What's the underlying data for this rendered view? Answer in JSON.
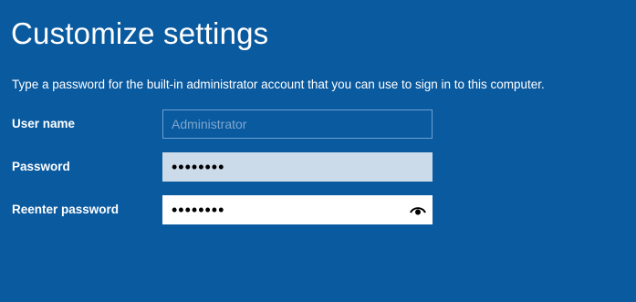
{
  "page": {
    "title": "Customize settings",
    "instruction": "Type a password for the built-in administrator account that you can use to sign in to this computer."
  },
  "form": {
    "username": {
      "label": "User name",
      "placeholder": "Administrator",
      "value": ""
    },
    "password": {
      "label": "Password",
      "value": "••••••••"
    },
    "reenter_password": {
      "label": "Reenter password",
      "value": "••••••••",
      "reveal_icon": "eye-icon"
    }
  },
  "colors": {
    "background": "#0a5aa0",
    "text": "#ffffff",
    "password_field_bg": "#ccdbe9",
    "reenter_field_bg": "#ffffff",
    "username_border": "#6f9fcf"
  }
}
